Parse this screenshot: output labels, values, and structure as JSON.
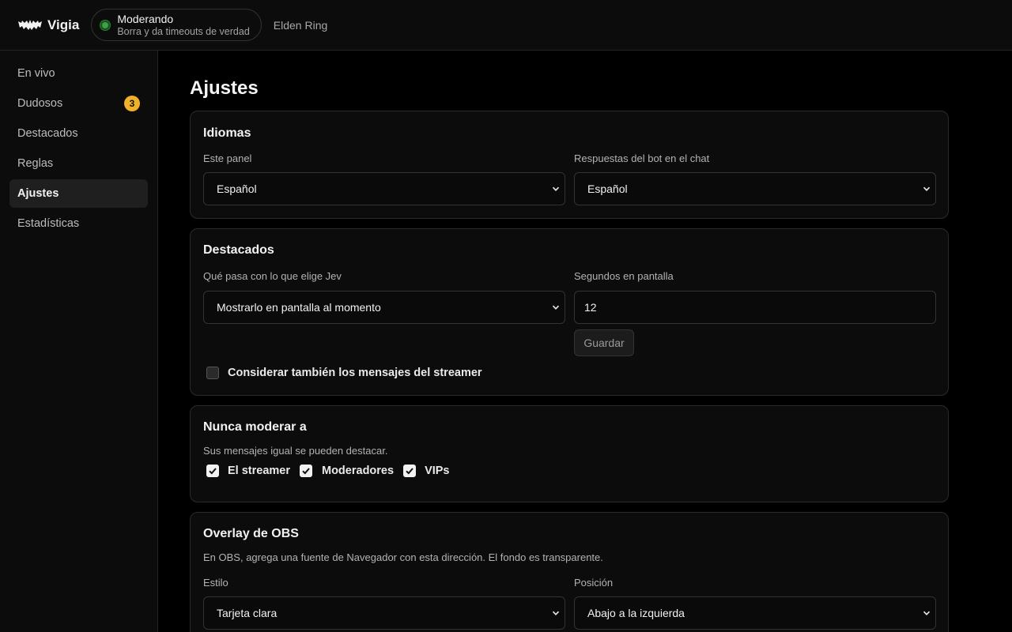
{
  "header": {
    "brand_name": "Vigia",
    "brand_icon": "bat-icon",
    "status": {
      "title": "Moderando",
      "subtitle": "Borra y da timeouts de verdad",
      "color": "#39a345"
    },
    "game": "Elden Ring"
  },
  "sidebar": {
    "items": [
      {
        "label": "En vivo",
        "active": false
      },
      {
        "label": "Dudosos",
        "active": false,
        "badge": "3"
      },
      {
        "label": "Destacados",
        "active": false
      },
      {
        "label": "Reglas",
        "active": false
      },
      {
        "label": "Ajustes",
        "active": true
      },
      {
        "label": "Estadísticas",
        "active": false
      }
    ],
    "badge_color": "#f0b129"
  },
  "main": {
    "title": "Ajustes",
    "languages": {
      "title": "Idiomas",
      "panel_label": "Este panel",
      "panel_value": "Español",
      "bot_label": "Respuestas del bot en el chat",
      "bot_value": "Español"
    },
    "highlights": {
      "title": "Destacados",
      "action_label": "Qué pasa con lo que elige Jev",
      "action_value": "Mostrarlo en pantalla al momento",
      "seconds_label": "Segundos en pantalla",
      "seconds_value": "12",
      "save_label": "Guardar",
      "streamer_checkbox_label": "Considerar también los mensajes del streamer",
      "streamer_checked": false
    },
    "never_moderate": {
      "title": "Nunca moderar a",
      "description": "Sus mensajes igual se pueden destacar.",
      "options": [
        {
          "label": "El streamer",
          "checked": true
        },
        {
          "label": "Moderadores",
          "checked": true
        },
        {
          "label": "VIPs",
          "checked": true
        }
      ]
    },
    "overlay": {
      "title": "Overlay de OBS",
      "description": "En OBS, agrega una fuente de Navegador con esta dirección. El fondo es transparente.",
      "style_label": "Estilo",
      "style_value": "Tarjeta clara",
      "position_label": "Posición",
      "position_value": "Abajo a la izquierda"
    }
  }
}
